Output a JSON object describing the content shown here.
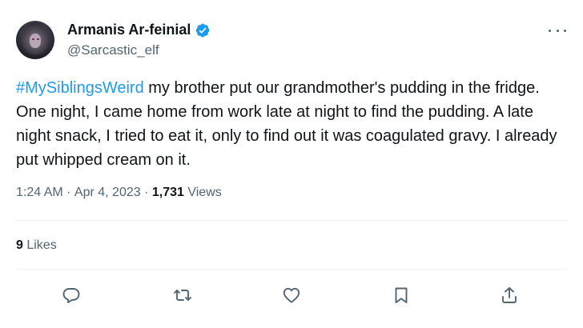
{
  "user": {
    "display_name": "Armanis Ar-feinial",
    "handle": "@Sarcastic_elf",
    "verified_color": "#1d9bf0"
  },
  "tweet": {
    "hashtag": "#MySiblingsWeird",
    "body": " my brother put our grandmother's pudding in the fridge. One night, I came home from work late at night to find the pudding. A late night snack, I tried to eat it, only to find out it was coagulated gravy. I already put whipped cream on it.",
    "time": "1:24 AM",
    "separator": " · ",
    "date": "Apr 4, 2023",
    "views_count": "1,731",
    "views_label": " Views"
  },
  "engagement": {
    "likes_count": "9",
    "likes_label": " Likes"
  },
  "actions": [
    "reply-icon",
    "retweet-icon",
    "like-icon",
    "bookmark-icon",
    "share-icon"
  ],
  "colors": {
    "text": "#0f1419",
    "secondary": "#536471",
    "accent": "#1d9bf0",
    "divider": "#eff3f4"
  }
}
